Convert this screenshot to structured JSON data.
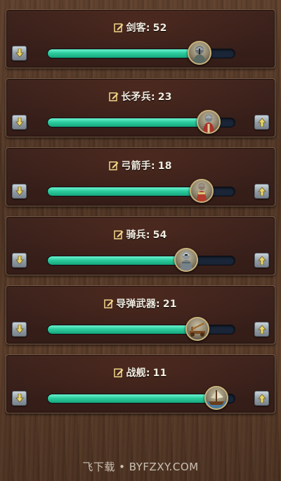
{
  "units": [
    {
      "name": "剑客",
      "count": "52",
      "level": 0.81,
      "icon": "swordsman-icon"
    },
    {
      "name": "长矛兵",
      "count": "23",
      "level": 0.86,
      "icon": "spearman-icon"
    },
    {
      "name": "弓箭手",
      "count": "18",
      "level": 0.82,
      "icon": "archer-icon"
    },
    {
      "name": "骑兵",
      "count": "54",
      "level": 0.74,
      "icon": "cavalry-icon"
    },
    {
      "name": "导弹武器",
      "count": "21",
      "level": 0.8,
      "icon": "catapult-icon"
    },
    {
      "name": "战舰",
      "count": "11",
      "level": 0.9,
      "icon": "warship-icon"
    }
  ],
  "watermark": "飞下载 • BYFZXY.COM",
  "colors": {
    "bar_fill": "#2ccd9f",
    "bar_track": "#1a2638",
    "panel_bg": "#3a201a",
    "title_text": "#f2ece0"
  }
}
